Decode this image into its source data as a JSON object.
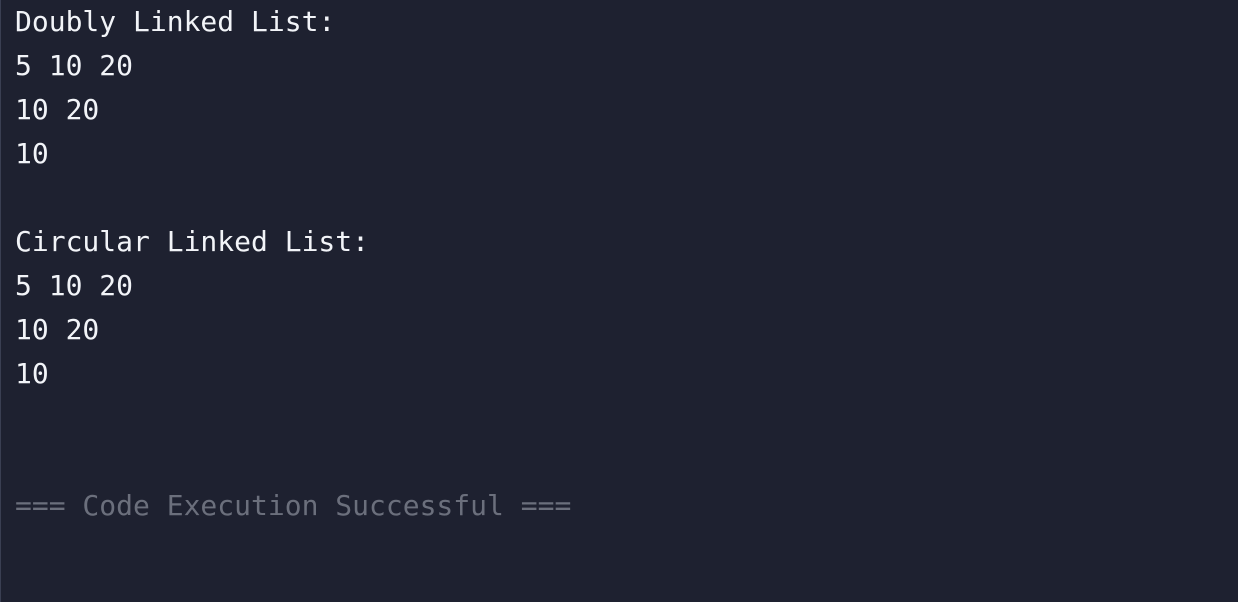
{
  "output": {
    "lines": [
      "Doubly Linked List:",
      "5 10 20",
      "10 20",
      "10",
      "",
      "Circular Linked List:",
      "5 10 20",
      "10 20",
      "10"
    ],
    "status": "=== Code Execution Successful ==="
  },
  "colors": {
    "background": "#1e2130",
    "text": "#f2f4f8",
    "status": "#6b6f7c"
  }
}
